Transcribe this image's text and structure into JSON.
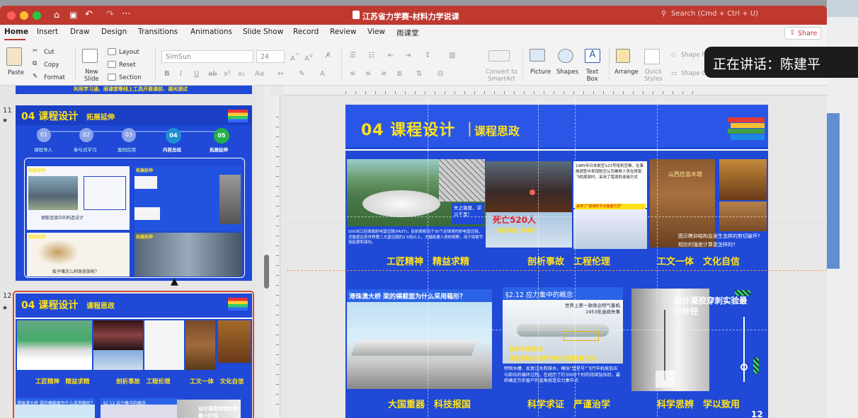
{
  "window": {
    "title": "江苏省力学赛-材料力学说课",
    "search_placeholder": "Search (Cmd + Ctrl + U)"
  },
  "tabs": [
    "Home",
    "Insert",
    "Draw",
    "Design",
    "Transitions",
    "Animations",
    "Slide Show",
    "Record",
    "Review",
    "View",
    "雨课堂"
  ],
  "share_label": "Share",
  "ribbon": {
    "paste": "Paste",
    "cut": "Cut",
    "copy": "Copy",
    "format": "Format",
    "new_slide": "New\nSlide",
    "layout": "Layout",
    "reset": "Reset",
    "section": "Section",
    "font": "SimSun",
    "size": "24",
    "convert": "Convert to\nSmartArt",
    "picture": "Picture",
    "shapes": "Shapes",
    "textbox": "Text\nBox",
    "arrange": "Arrange",
    "quick_styles": "Quick\nStyles",
    "shape_fill": "Shape F",
    "shape_outline": "Shape O"
  },
  "speaker_label": "正在讲话：陈建平",
  "thumbnails": {
    "prev_caption": "利用学习通、雨课堂等线上工具开展课前、课间测试",
    "slide11": {
      "number": "11",
      "title": "04 课程设计",
      "subtitle": "拓展延伸",
      "steps": [
        {
          "num": "01",
          "label": "课程导入"
        },
        {
          "num": "02",
          "label": "参与式学习"
        },
        {
          "num": "03",
          "label": "案例应用"
        },
        {
          "num": "04",
          "label": "内容总结"
        },
        {
          "num": "05",
          "label": "拓展延伸"
        }
      ],
      "box1_title": "拓展延伸",
      "box2_title": "拓展延伸",
      "box3_title": "拓展延伸",
      "box4_title": "拓展延伸",
      "cap1": "钢筋连接中的构造设计",
      "cap2": "蚊子嘴怎么刺穿皮肤呢？"
    },
    "slide12": {
      "number": "12",
      "title": "04 课程设计",
      "subtitle": "课程思政",
      "labels": [
        "工匠精神　精益求精",
        "剖析事故　工程伦理",
        "工文一体　文化自信"
      ],
      "box_title": "港珠澳大桥 梁的横截面为什么采用箱形？",
      "box2_title": "§2.12 应力集中的概念",
      "exp": "设计凝胶穿刺实验最小针径"
    }
  },
  "slide": {
    "title": "04 课程设计",
    "subtitle": "课程思政",
    "number": "12",
    "fast_text": "500米口径球面射电望远镜(FAST)，反射面相当于30个足球场的射电望远镜，灵敏度达到世界第二大望远镜的2.5倍以上，大幅拓展人类的视野，用于探索宇宙起源和演化。",
    "fast_overlay": "失之毫厘，谬以千里！",
    "accident_text": "1985年日本航空123号班机空难，在事故调查中发现航空公司维修人员在修复飞机尾部时，采用了错误的连接方式",
    "accident_highlight": "采用了\"错误的节点连接方式\"",
    "accident_big": "死亡520人",
    "accident_sub": "起因只是一排铆钉",
    "bullet1": "图示榫卯结构会发生怎样的剪切破坏?",
    "bullet2": "相应的强度计算是怎样的?",
    "wood_label": "山西应县木塔",
    "row1_labels": [
      "工匠精神　精益求精",
      "剖析事故　工程伦理",
      "工文一体　文化自信"
    ],
    "bridge_title": "港珠澳大桥 梁的横截面为什么采用箱形？",
    "concept_title": "§2.12 应力集中的概念",
    "plane_caption": "世界上第一款商业喷气客机\n1953年连续失事",
    "knowledge": "知识不是死的！",
    "knowledge2": "要有求知识的勇气和对问题探索方法！",
    "concept_text": "特制水槽、反复注水和排水，模拟\"彗星号\"飞行中机舱加压与卸压的循环过程。在经历了约3000个时的持续加压后，最终确定方形窗户的直角就是应力集中点",
    "exp_title": "设计凝胶穿刺实验最小针径",
    "row2_labels": [
      "大国重器　科技报国",
      "科学求证　严谨治学",
      "科学思辨　学以致用"
    ]
  },
  "colors": {
    "titlebar": "#c0392f",
    "slide_bg": "#1f49d6",
    "accent_yellow": "#ffe21a"
  }
}
